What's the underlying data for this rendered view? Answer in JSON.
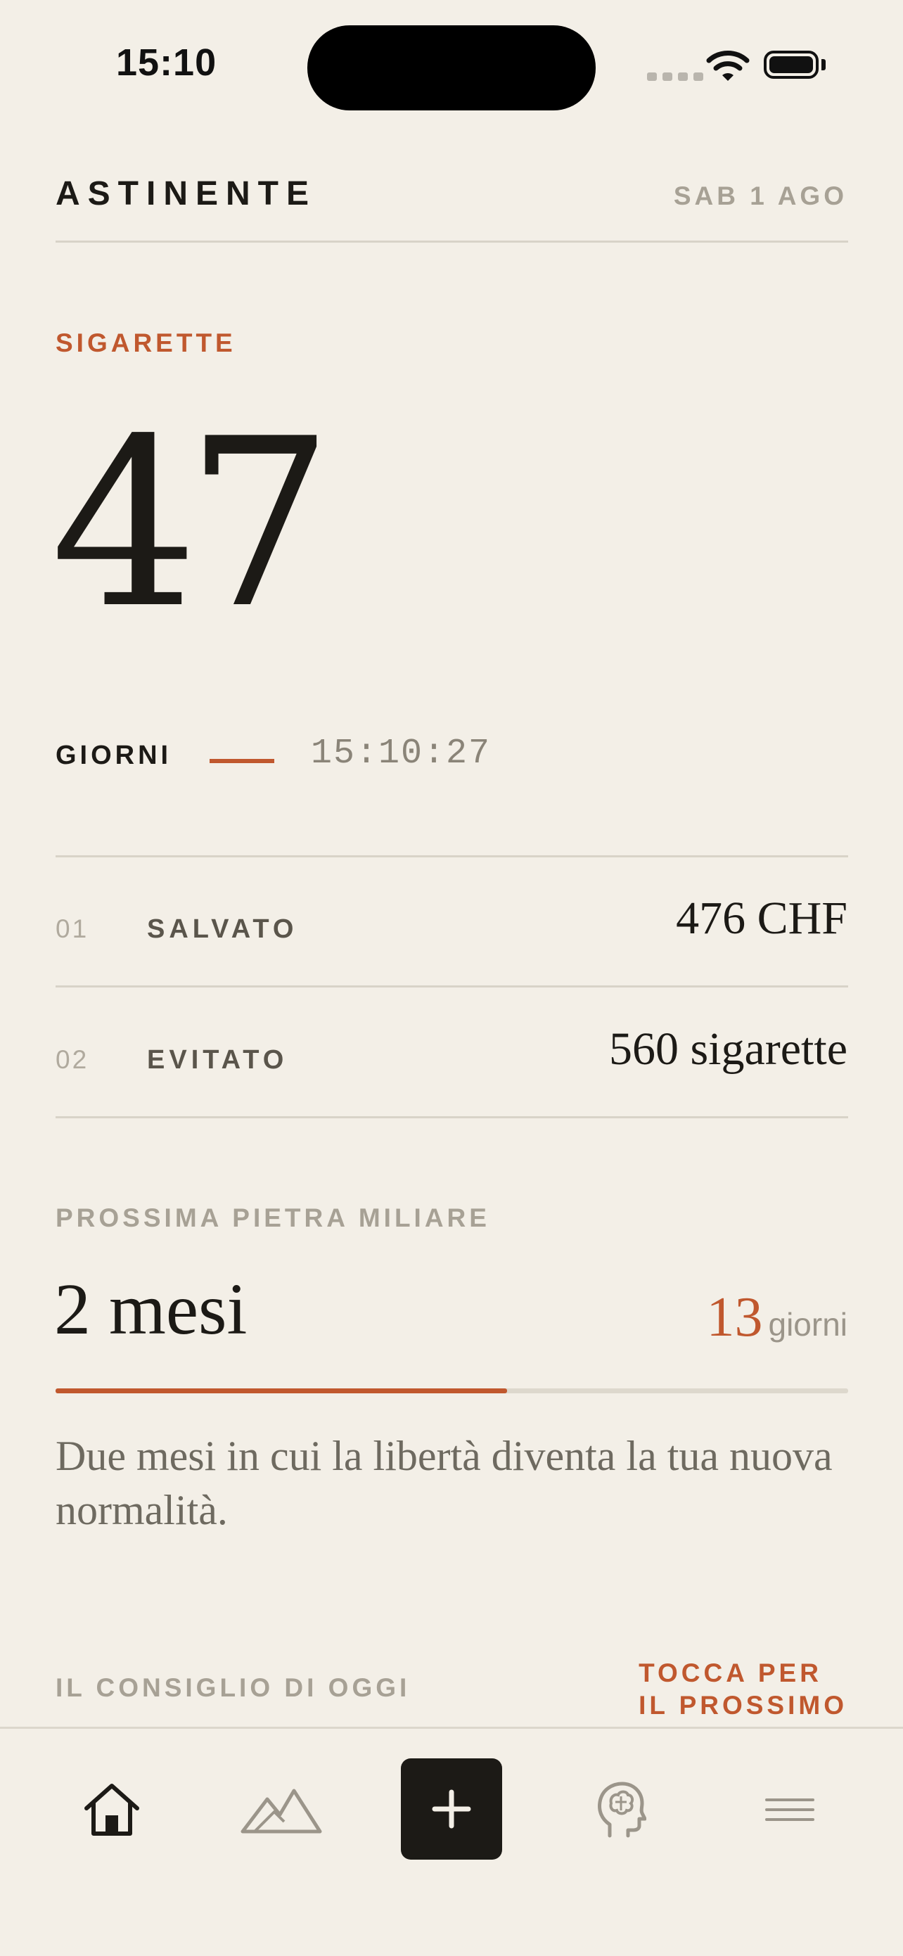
{
  "status_bar": {
    "time": "15:10"
  },
  "header": {
    "brand": "ASTINENTE",
    "date": "SAB 1 AGO"
  },
  "tracker": {
    "category": "SIGARETTE",
    "days_value": "47",
    "days_label": "GIORNI",
    "clock": "15:10:27"
  },
  "stats": [
    {
      "index": "01",
      "label": "SALVATO",
      "value": "476 CHF"
    },
    {
      "index": "02",
      "label": "EVITATO",
      "value": "560 sigarette"
    }
  ],
  "milestone": {
    "eyebrow": "PROSSIMA PIETRA MILIARE",
    "title": "2 mesi",
    "remaining_value": "13",
    "remaining_unit": "giorni",
    "progress": 0.57,
    "description": "Due mesi in cui la libertà diventa la tua nuova normalità."
  },
  "tip": {
    "eyebrow": "IL CONSIGLIO DI OGGI",
    "action_line1": "TOCCA PER",
    "action_line2": "IL PROSSIMO"
  },
  "tab_bar": {
    "items": [
      "home-icon",
      "mountains-icon",
      "plus-icon",
      "brain-head-icon",
      "menu-icon"
    ],
    "active": "home-icon"
  },
  "colors": {
    "accent": "#c0582e",
    "background": "#f3efe7",
    "ink": "#1c1a16",
    "muted": "#a7a195"
  }
}
